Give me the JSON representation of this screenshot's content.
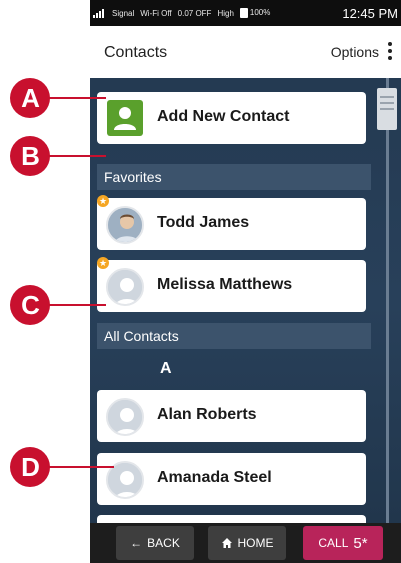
{
  "status_bar": {
    "signal": "Signal",
    "wifi": "Wi-Fi Off",
    "speed": "0.07 OFF",
    "volume": "High",
    "battery": "100%",
    "time": "12:45 PM"
  },
  "header": {
    "title": "Contacts",
    "options_label": "Options"
  },
  "add_contact": {
    "label": "Add New Contact"
  },
  "sections": {
    "favorites": "Favorites",
    "all_contacts": "All Contacts",
    "letter_a": "A"
  },
  "favorites": [
    {
      "name": "Todd James",
      "favorite": true
    },
    {
      "name": "Melissa Matthews",
      "favorite": true
    }
  ],
  "contacts": [
    {
      "name": "Alan Roberts"
    },
    {
      "name": "Amanada Steel"
    }
  ],
  "bottom_bar": {
    "back_label": "BACK",
    "home_label": "HOME",
    "call_label": "CALL",
    "call_number": "5*"
  },
  "callouts": [
    "A",
    "B",
    "C",
    "D"
  ],
  "colors": {
    "callout": "#c8102e",
    "call_button": "#b8245a",
    "add_icon": "#5aa02c",
    "favorite_star": "#f5a623",
    "list_background": "#243a52"
  }
}
